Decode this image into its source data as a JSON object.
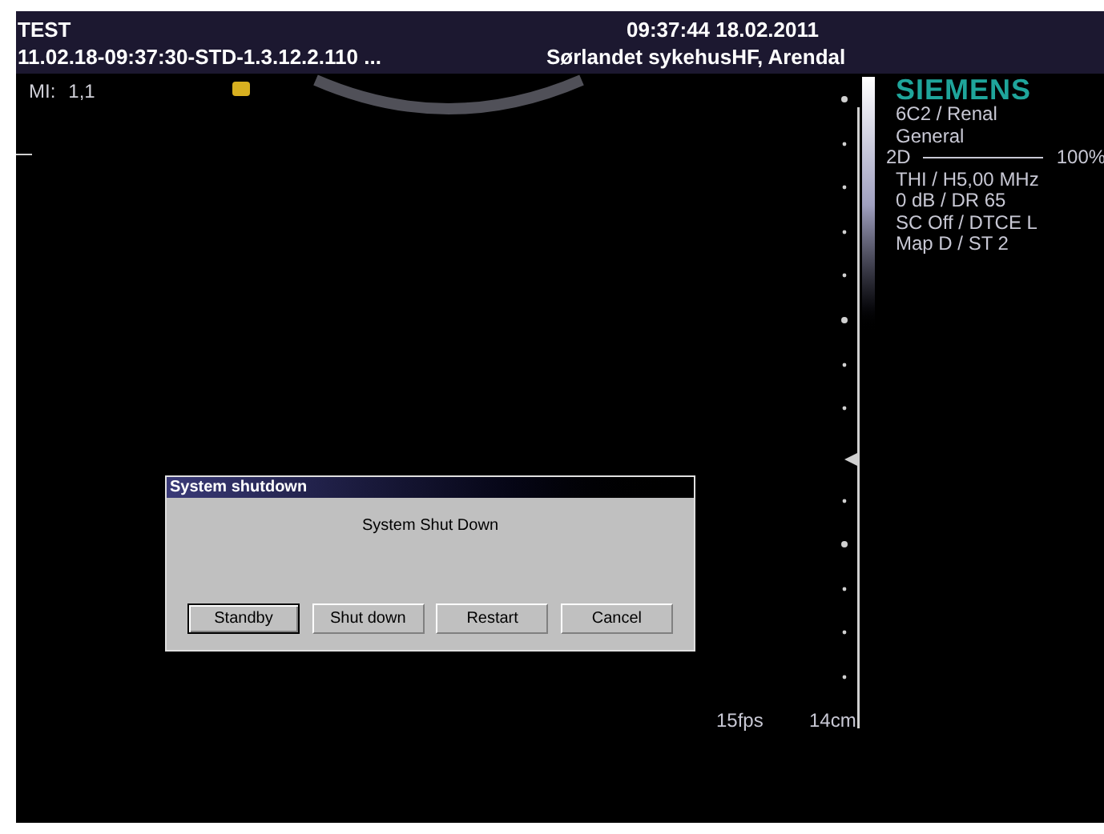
{
  "header": {
    "patient": "TEST",
    "study_id": "11.02.18-09:37:30-STD-1.3.12.2.110 ...",
    "datetime": "09:37:44 18.02.2011",
    "institution": "Sørlandet sykehusHF, Arendal"
  },
  "mi": {
    "label": "MI:",
    "value": "1,1"
  },
  "brand": "SIEMENS",
  "params_top": [
    "6C2 / Renal",
    "General"
  ],
  "mode": {
    "label": "2D",
    "value": "100%"
  },
  "params": [
    "THI / H5,00 MHz",
    "0 dB / DR 65",
    "SC Off / DTCE L",
    "Map D / ST 2"
  ],
  "frame_rate": "15fps",
  "depth": "14cm",
  "dialog": {
    "title": "System shutdown",
    "message": "System Shut Down",
    "buttons": [
      {
        "label": "Standby",
        "selected": true
      },
      {
        "label": "Shut down",
        "selected": false
      },
      {
        "label": "Restart",
        "selected": false
      },
      {
        "label": "Cancel",
        "selected": false
      }
    ]
  }
}
